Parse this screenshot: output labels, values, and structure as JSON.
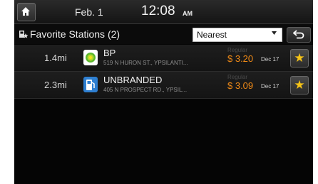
{
  "status": {
    "date": "Feb. 1",
    "time": "12:08",
    "ampm": "AM"
  },
  "header": {
    "title": "Favorite Stations (2)",
    "sort_value": "Nearest"
  },
  "stations": [
    {
      "distance": "1.4mi",
      "name": "BP",
      "address": "519 N HURON ST., YPSILANTI...",
      "grade": "Regular",
      "price": "$ 3.20",
      "date": "Dec 17"
    },
    {
      "distance": "2.3mi",
      "name": "UNBRANDED",
      "address": "405 N PROSPECT RD., YPSIL...",
      "grade": "Regular",
      "price": "$ 3.09",
      "date": "Dec 17"
    }
  ],
  "icons": {
    "home": "home-icon",
    "favorite": "favorite-stations-icon",
    "dropdown": "chevron-down-icon",
    "back": "back-arrow-icon",
    "bp": "bp-logo-icon",
    "fuel": "fuel-pump-icon",
    "star": "star-icon"
  },
  "colors": {
    "price": "#f08a17",
    "star": "#f7c417",
    "background": "#050505"
  }
}
